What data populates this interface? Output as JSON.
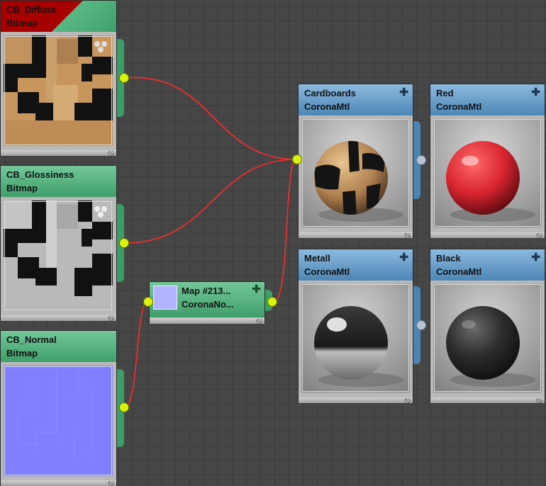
{
  "nodes": {
    "cb_diffuse": {
      "name": "CB_Diffuse",
      "type": "Bitmap"
    },
    "cb_glossiness": {
      "name": "CB_Glossiness",
      "type": "Bitmap"
    },
    "cb_normal": {
      "name": "CB_Normal",
      "type": "Bitmap"
    },
    "corona_normal": {
      "name": "Map #213...",
      "type": "CoronaNo..."
    },
    "cardboards": {
      "name": "Cardboards",
      "type": "CoronaMtl"
    },
    "red": {
      "name": "Red",
      "type": "CoronaMtl"
    },
    "metall": {
      "name": "Metall",
      "type": "CoronaMtl"
    },
    "black": {
      "name": "Black",
      "type": "CoronaMtl"
    }
  },
  "icons": {
    "expand": "plus-icon"
  },
  "colors": {
    "map_header": "#4fae79",
    "material_header": "#5f97c6",
    "socket": "#d8f20c",
    "wire": "#ff2a2a",
    "normal_map": "#7f7fff",
    "background": "#464646"
  }
}
